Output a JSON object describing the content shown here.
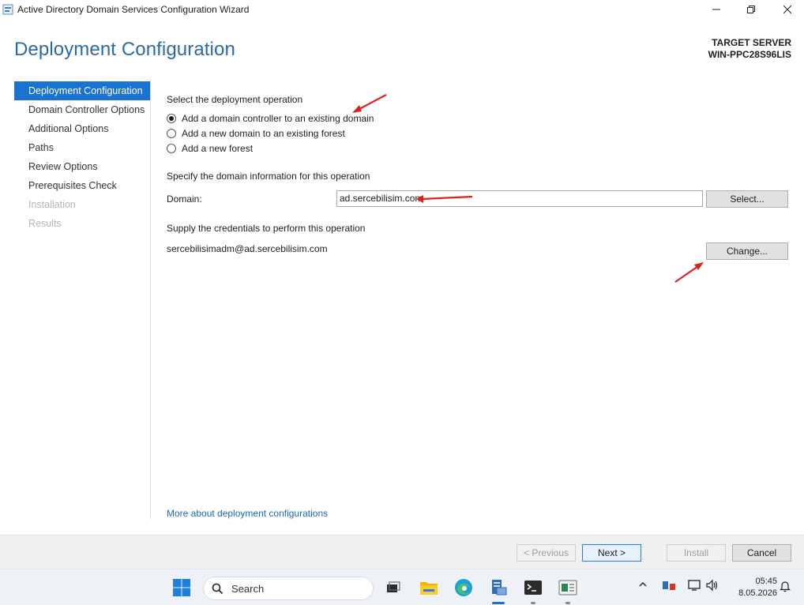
{
  "window": {
    "title": "Active Directory Domain Services Configuration Wizard",
    "minimize_icon": "minimize-icon",
    "maximize_icon": "restore-icon",
    "close_icon": "close-icon"
  },
  "header": {
    "title": "Deployment Configuration",
    "target_label": "TARGET SERVER",
    "target_name": "WIN-PPC28S96LIS"
  },
  "nav": {
    "items": [
      {
        "label": "Deployment Configuration",
        "state": "active"
      },
      {
        "label": "Domain Controller Options",
        "state": "normal"
      },
      {
        "label": "Additional Options",
        "state": "normal"
      },
      {
        "label": "Paths",
        "state": "normal"
      },
      {
        "label": "Review Options",
        "state": "normal"
      },
      {
        "label": "Prerequisites Check",
        "state": "normal"
      },
      {
        "label": "Installation",
        "state": "disabled"
      },
      {
        "label": "Results",
        "state": "disabled"
      }
    ]
  },
  "main": {
    "operation_heading": "Select the deployment operation",
    "options": [
      {
        "label": "Add a domain controller to an existing domain",
        "selected": true
      },
      {
        "label": "Add a new domain to an existing forest",
        "selected": false
      },
      {
        "label": "Add a new forest",
        "selected": false
      }
    ],
    "domain_heading": "Specify the domain information for this operation",
    "domain_label": "Domain:",
    "domain_value": "ad.sercebilisim.com",
    "select_button": "Select...",
    "credentials_heading": "Supply the credentials to perform this operation",
    "credentials_value": "sercebilisimadm@ad.sercebilisim.com",
    "change_button": "Change...",
    "more_link": "More about deployment configurations"
  },
  "footer": {
    "previous": "< Previous",
    "next": "Next >",
    "install": "Install",
    "cancel": "Cancel"
  },
  "taskbar": {
    "search_placeholder": "Search",
    "time": "05:45",
    "date": "8.05.2026"
  },
  "colors": {
    "accent": "#1a73d1",
    "heading": "#2b6aa6",
    "annotation_arrow": "#e01e1e"
  }
}
